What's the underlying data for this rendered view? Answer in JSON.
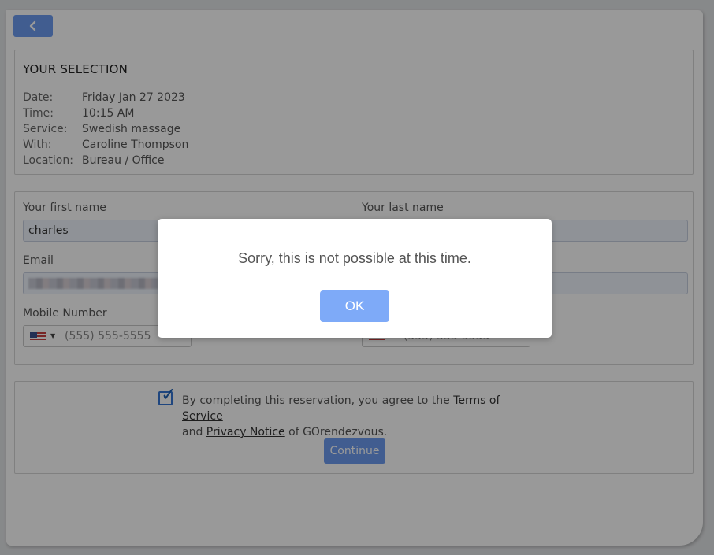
{
  "selection": {
    "title": "YOUR SELECTION",
    "rows": [
      {
        "key": "Date:",
        "value": "Friday Jan 27 2023"
      },
      {
        "key": "Time:",
        "value": "10:15 AM"
      },
      {
        "key": "Service:",
        "value": "Swedish massage"
      },
      {
        "key": "With:",
        "value": "Caroline Thompson"
      },
      {
        "key": "Location:",
        "value": "Bureau / Office"
      }
    ]
  },
  "form": {
    "first_name_label": "Your first name",
    "first_name_value": "charles",
    "last_name_label": "Your last name",
    "email_label": "Email",
    "mobile_label": "Mobile Number",
    "mobile_placeholder": "(555) 555-5555",
    "second_phone_placeholder": "(555) 555-5555"
  },
  "terms": {
    "prefix": "By completing this reservation, you agree to the ",
    "tos_link": "Terms of Service",
    "and": "and ",
    "privacy_link": "Privacy Notice",
    "suffix": " of GOrendezvous.",
    "checked": true,
    "continue_label": "Continue"
  },
  "dialog": {
    "message": "Sorry, this is not possible at this time.",
    "ok_label": "OK"
  },
  "colors": {
    "accent": "#6d9cf0",
    "ok_button": "#7eaaf8"
  },
  "icons": {
    "back": "chevron-left-icon",
    "flag": "us-flag-icon",
    "check": "checkmark-icon"
  }
}
